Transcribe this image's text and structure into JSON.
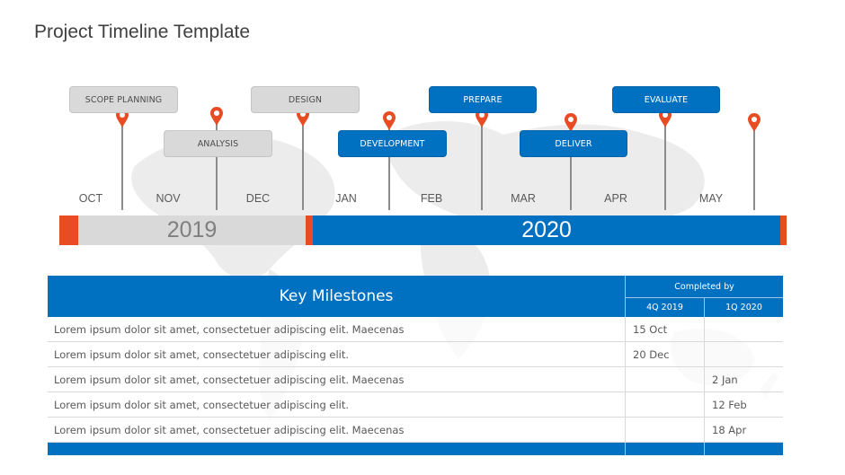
{
  "title": "Project Timeline Template",
  "colors": {
    "blue": "#0070c0",
    "gray_box": "#d9d9d9",
    "pin_orange": "#e84c22",
    "stem_gray": "#8c8c8c"
  },
  "stages": [
    {
      "label": "SCOPE PLANNING",
      "style": "gray",
      "row": "top"
    },
    {
      "label": "ANALYSIS",
      "style": "gray",
      "row": "bottom"
    },
    {
      "label": "DESIGN",
      "style": "gray",
      "row": "top"
    },
    {
      "label": "DEVELOPMENT",
      "style": "blue",
      "row": "bottom"
    },
    {
      "label": "PREPARE",
      "style": "blue",
      "row": "top"
    },
    {
      "label": "DELIVER",
      "style": "blue",
      "row": "bottom"
    },
    {
      "label": "EVALUATE",
      "style": "blue",
      "row": "top"
    }
  ],
  "pin_icon": "map-pin-icon",
  "months": [
    "OCT",
    "NOV",
    "DEC",
    "JAN",
    "FEB",
    "MAR",
    "APR",
    "MAY"
  ],
  "years": {
    "first": "2019",
    "second": "2020"
  },
  "table": {
    "header": "Key Milestones",
    "completed_by": "Completed by",
    "quarters": [
      "4Q 2019",
      "1Q 2020"
    ],
    "rows": [
      {
        "desc": "Lorem ipsum dolor sit amet, consectetuer adipiscing elit.  Maecenas",
        "q4_2019": "15 Oct",
        "q1_2020": ""
      },
      {
        "desc": "Lorem ipsum dolor sit amet, consectetuer adipiscing elit.",
        "q4_2019": "20 Dec",
        "q1_2020": ""
      },
      {
        "desc": "Lorem ipsum dolor sit amet, consectetuer adipiscing elit.  Maecenas",
        "q4_2019": "",
        "q1_2020": "2 Jan"
      },
      {
        "desc": "Lorem ipsum dolor sit amet, consectetuer adipiscing elit.",
        "q4_2019": "",
        "q1_2020": "12 Feb"
      },
      {
        "desc": "Lorem ipsum dolor sit amet, consectetuer adipiscing elit.  Maecenas",
        "q4_2019": "",
        "q1_2020": "18 Apr"
      }
    ]
  }
}
